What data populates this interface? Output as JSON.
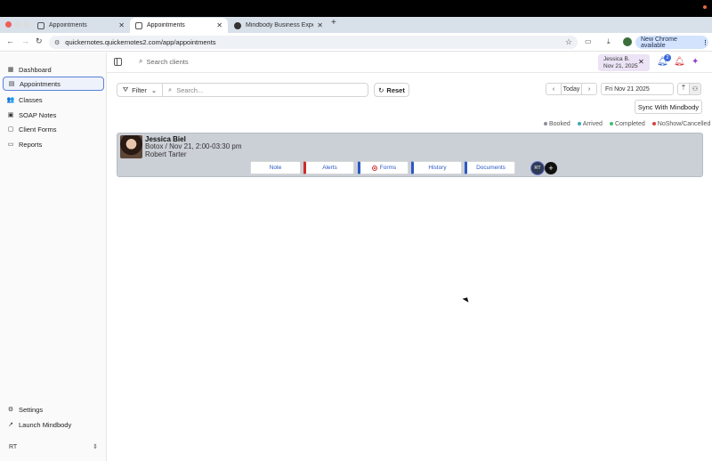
{
  "browser": {
    "tabs": [
      {
        "title": "Appointments"
      },
      {
        "title": "Appointments"
      },
      {
        "title": "Mindbody Business Experien"
      }
    ],
    "url": "quickernotes.quickernotes2.com/app/appointments",
    "new_chrome_label": "New Chrome available"
  },
  "sidebar": {
    "items": [
      {
        "label": "Dashboard",
        "icon": "dashboard-icon"
      },
      {
        "label": "Appointments",
        "icon": "calendar-icon"
      },
      {
        "label": "Classes",
        "icon": "users-icon"
      },
      {
        "label": "SOAP Notes",
        "icon": "notes-icon"
      },
      {
        "label": "Client Forms",
        "icon": "forms-icon"
      },
      {
        "label": "Reports",
        "icon": "reports-icon"
      }
    ],
    "bottom": [
      {
        "label": "Settings",
        "icon": "gear-icon"
      },
      {
        "label": "Launch Mindbody",
        "icon": "launch-icon"
      }
    ],
    "user_initials": "RT"
  },
  "appbar": {
    "search_placeholder": "Search clients",
    "user_chip_name": "Jessica B.",
    "user_chip_date": "Nov 21, 2025",
    "notification_count": "2"
  },
  "toolbar": {
    "filter_label": "Filter",
    "search_placeholder": "Search...",
    "reset_label": "Reset",
    "today_label": "Today",
    "date_value": "Fri Nov 21 2025",
    "sync_label": "Sync With Mindbody"
  },
  "legend": [
    {
      "label": "Booked",
      "color": "#8a8f99"
    },
    {
      "label": "Arrived",
      "color": "#3aa6b9"
    },
    {
      "label": "Completed",
      "color": "#3cbf6a"
    },
    {
      "label": "NoShow/Cancelled",
      "color": "#d84040"
    }
  ],
  "appointment": {
    "client_name": "Jessica Biel",
    "service_time": "Botox / Nov 21, 2:00-03:30 pm",
    "provider": "Robert Tarter",
    "actions": {
      "note": "Note",
      "alerts": "Alerts",
      "forms": "Forms",
      "history": "History",
      "documents": "Documents"
    },
    "assignee_initials": "RT"
  },
  "colors": {
    "accent": "#2b59c3",
    "card_bg": "#cbcfd6"
  }
}
